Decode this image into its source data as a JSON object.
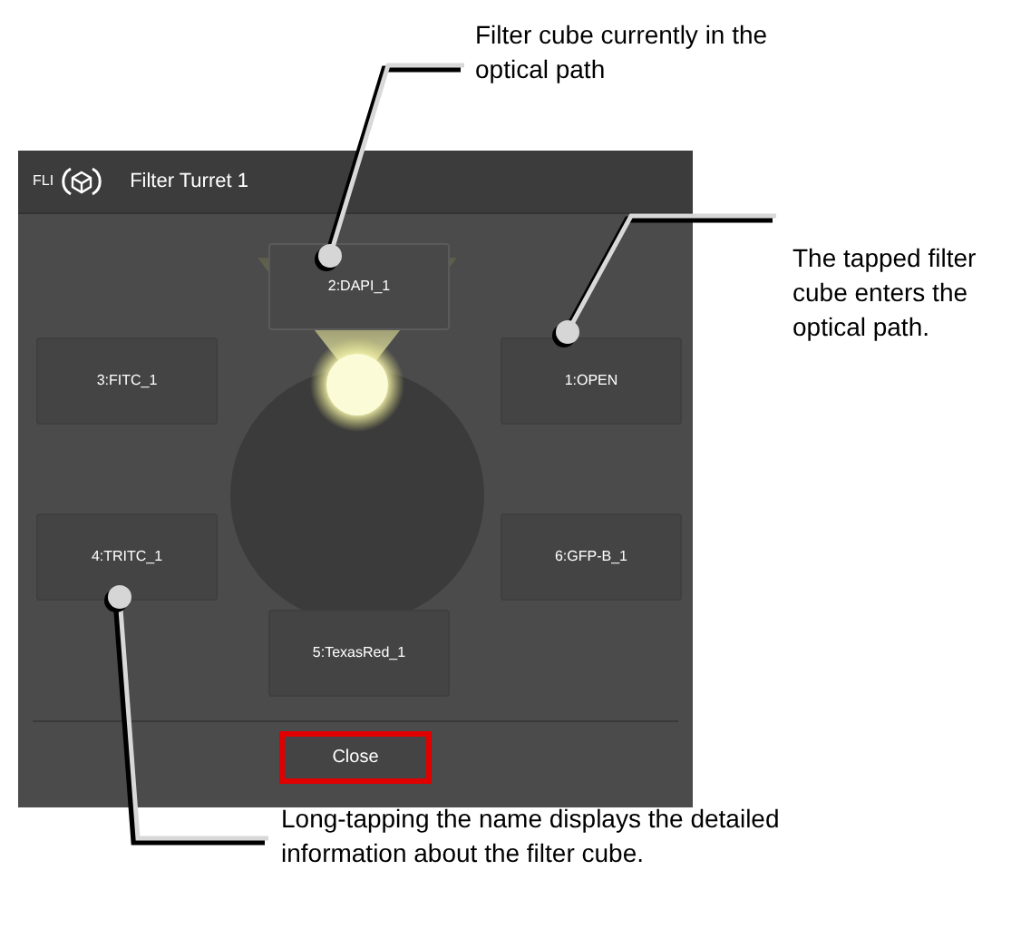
{
  "window": {
    "title": "Filter Turret 1",
    "logo_text": "FLI"
  },
  "cubes": [
    {
      "label": "2:DAPI_1",
      "selected": true
    },
    {
      "label": "3:FITC_1",
      "selected": false
    },
    {
      "label": "1:OPEN",
      "selected": false
    },
    {
      "label": "4:TRITC_1",
      "selected": false
    },
    {
      "label": "6:GFP-B_1",
      "selected": false
    },
    {
      "label": "5:TexasRed_1",
      "selected": false
    }
  ],
  "close_button": {
    "label": "Close",
    "highlighted": true
  },
  "annotations": [
    {
      "text": "Filter cube currently in the optical path"
    },
    {
      "text": "The tapped filter cube enters the optical path."
    },
    {
      "text": "Long-tapping the name displays the detailed information about the filter cube."
    }
  ]
}
